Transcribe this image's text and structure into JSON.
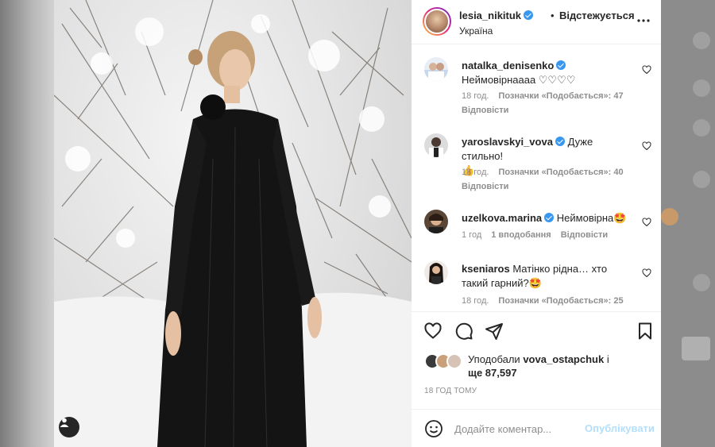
{
  "author": {
    "username": "lesia_nikituk",
    "separator": "•",
    "follow_status": "Відстежується",
    "location": "Україна"
  },
  "comments": [
    {
      "username": "natalka_denisenko",
      "verified": true,
      "text_line1": "Неймовірнаааа ♡♡♡♡",
      "text_line2": "",
      "time": "18 год.",
      "likes": "Позначки «Подобається»: 47",
      "reply": "Відповісти"
    },
    {
      "username": "yaroslavskyi_vova",
      "verified": true,
      "text_line1": "Дуже стильно!",
      "text_line2": "👍",
      "time": "18 год.",
      "likes": "Позначки «Подобається»: 40",
      "reply": "Відповісти"
    },
    {
      "username": "uzelkova.marina",
      "verified": true,
      "text_line1": "Неймовірна🤩",
      "text_line2": "",
      "time": "1 год",
      "likes": "1 вподобання",
      "reply": "Відповісти"
    },
    {
      "username": "kseniaros",
      "verified": false,
      "text_line1": "Матінко рідна… хто",
      "text_line2": "такий гарний?🤩",
      "time": "18 год.",
      "likes": "Позначки «Подобається»: 25",
      "reply": ""
    }
  ],
  "likes": {
    "prefix": "Уподобали",
    "user": "vova_ostapchuk",
    "suffix": "і",
    "more": "ще 87,597"
  },
  "timestamp": "18 ГОД ТОМУ",
  "add_comment": {
    "placeholder": "Додайте коментар...",
    "post_label": "Опублікувати"
  },
  "colors": {
    "verified": "#3897f0",
    "post_button_disabled": "#b2dffc",
    "meta_text": "#8e8e8e"
  }
}
